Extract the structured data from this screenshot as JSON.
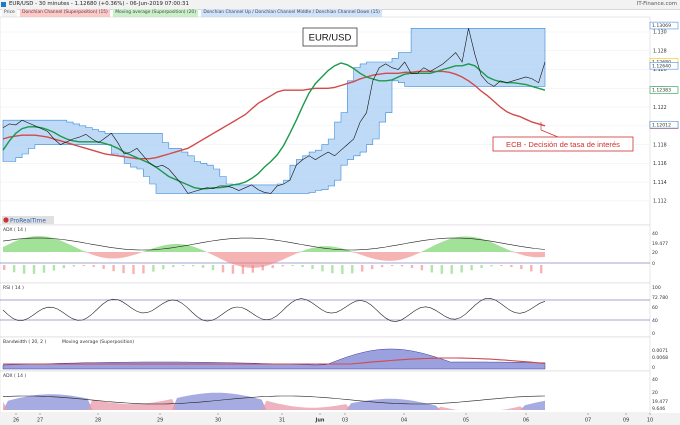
{
  "header": {
    "title": "EUR/USD - 30 minutes - 1.12680 (+0.36%) - 06-Jun-2019 07:00:31",
    "brand": "IT-Finance.com"
  },
  "legend": [
    {
      "text": "Price",
      "color": "#f2f2f2"
    },
    {
      "text": "Donchian Channel (Superposition) (15)",
      "color": "#ffc9c9"
    },
    {
      "text": "Moving average (Superposition) (20)",
      "color": "#c9f0c9"
    },
    {
      "text": "Donchian Channel Up / Donchian Channel Middle / Donchian Channel Down (15)",
      "color": "#cfe3fb"
    }
  ],
  "watermark": "ProRealTime",
  "annotations": {
    "pair_label": "EUR/USD",
    "ecb_label": "ECB - Decisión de tasa de interés"
  },
  "price_tags": [
    {
      "text": "1.13069",
      "value": 1.13069,
      "color": "#4a8fe0"
    },
    {
      "text": "1.12680",
      "value": 1.1268,
      "color": "#f0c000"
    },
    {
      "text": "1.12640",
      "value": 1.1264,
      "color": "#4a8fe0"
    },
    {
      "text": "1.12383",
      "value": 1.12383,
      "color": "#1a9a4a"
    },
    {
      "text": "1.12007",
      "value": 1.12007,
      "color": "#d24a4a"
    },
    {
      "text": "1.12012",
      "value": 1.12012,
      "color": "#4a8fe0"
    }
  ],
  "panel_labels": {
    "adx": "ADX ( 14 )",
    "rsi": "RSI ( 14 )",
    "bw": "Bandwidth ( 20, 2 )",
    "bw_ma": "Moving average (Superposition)",
    "adx2": "ADX ( 14 )"
  },
  "panel_tags": {
    "adx": [
      "40",
      "19.477",
      "20",
      "0"
    ],
    "rsi": [
      "100",
      "72.780",
      "60",
      "40",
      "0"
    ],
    "bw": [
      "0.0071",
      "0.0068",
      "0"
    ],
    "adx2": [
      "40",
      "20",
      "19.477",
      "9.646"
    ]
  },
  "chart_data": {
    "type": "line",
    "symbol": "EUR/USD",
    "timeframe": "30 minutes",
    "x_ticks": [
      "26",
      "27",
      "28",
      "29",
      "30",
      "31",
      "Jun",
      "03",
      "04",
      "05",
      "06",
      "07",
      "09",
      "10"
    ],
    "y_ticks": [
      1.112,
      1.114,
      1.116,
      1.118,
      1.12,
      1.122,
      1.124,
      1.126,
      1.128,
      1.13
    ],
    "ylim": [
      1.1106,
      1.1316
    ],
    "last_price": 1.1268,
    "series": [
      {
        "name": "Price",
        "color": "#000000",
        "values": [
          1.1198,
          1.1202,
          1.1201,
          1.1206,
          1.1203,
          1.12,
          1.1197,
          1.1194,
          1.1186,
          1.118,
          1.1183,
          1.1186,
          1.1188,
          1.1191,
          1.1186,
          1.1182,
          1.1187,
          1.1192,
          1.1182,
          1.117,
          1.1172,
          1.1176,
          1.1168,
          1.116,
          1.1156,
          1.1158,
          1.1154,
          1.1146,
          1.1138,
          1.1128,
          1.113,
          1.1132,
          1.1134,
          1.1133,
          1.1136,
          1.1136,
          1.1134,
          1.1131,
          1.1134,
          1.1137,
          1.1132,
          1.1129,
          1.1128,
          1.1136,
          1.1138,
          1.1142,
          1.1158,
          1.1164,
          1.1168,
          1.1164,
          1.1168,
          1.1172,
          1.1168,
          1.1174,
          1.118,
          1.1186,
          1.1204,
          1.1214,
          1.1248,
          1.1262,
          1.1266,
          1.1262,
          1.126,
          1.1268,
          1.1256,
          1.1256,
          1.1262,
          1.1258,
          1.1262,
          1.1266,
          1.1272,
          1.1278,
          1.1268,
          1.1304,
          1.1276,
          1.1254,
          1.1246,
          1.1242,
          1.1248,
          1.1246,
          1.1248,
          1.125,
          1.1252,
          1.125,
          1.1246,
          1.1268
        ]
      },
      {
        "name": "Moving average (Superposition) (20)",
        "color": "#1a9a4a",
        "values": [
          1.1174,
          1.1184,
          1.1192,
          1.1197,
          1.1199,
          1.1199,
          1.1198,
          1.1196,
          1.1193,
          1.1189,
          1.1186,
          1.1184,
          1.1183,
          1.1183,
          1.1183,
          1.1183,
          1.1181,
          1.1179,
          1.1176,
          1.1172,
          1.1169,
          1.1166,
          1.1163,
          1.116,
          1.1156,
          1.1151,
          1.1146,
          1.1143,
          1.114,
          1.1137,
          1.1134,
          1.1133,
          1.1133,
          1.1134,
          1.1134,
          1.1135,
          1.1137,
          1.1138,
          1.114,
          1.1144,
          1.1149,
          1.1156,
          1.1162,
          1.1169,
          1.1179,
          1.1192,
          1.1206,
          1.1221,
          1.1235,
          1.1245,
          1.1252,
          1.1259,
          1.1264,
          1.1267,
          1.1265,
          1.1261,
          1.1256,
          1.1252,
          1.125,
          1.1248,
          1.1248,
          1.1249,
          1.1252,
          1.1255,
          1.1256,
          1.1256,
          1.1256,
          1.1256,
          1.1258,
          1.126,
          1.1262,
          1.1264,
          1.1264,
          1.1266,
          1.1264,
          1.1258,
          1.1252,
          1.1249,
          1.1247,
          1.1246,
          1.1246,
          1.1245,
          1.1244,
          1.1242,
          1.124,
          1.1238
        ]
      },
      {
        "name": "Moving average (Superposition) (20) red",
        "color": "#d24a4a",
        "values": [
          1.1186,
          1.1188,
          1.1189,
          1.119,
          1.119,
          1.119,
          1.1189,
          1.1188,
          1.1186,
          1.1184,
          1.1182,
          1.118,
          1.1178,
          1.1176,
          1.1174,
          1.1172,
          1.117,
          1.1169,
          1.1168,
          1.1167,
          1.1166,
          1.1165,
          1.1165,
          1.1165,
          1.1166,
          1.1168,
          1.117,
          1.1172,
          1.1174,
          1.1176,
          1.118,
          1.1184,
          1.1188,
          1.1192,
          1.1196,
          1.12,
          1.1204,
          1.1208,
          1.1212,
          1.1218,
          1.1224,
          1.1228,
          1.1232,
          1.1236,
          1.1238,
          1.1238,
          1.1238,
          1.1238,
          1.1239,
          1.124,
          1.124,
          1.124,
          1.1241,
          1.1243,
          1.1245,
          1.1247,
          1.125,
          1.1252,
          1.1254,
          1.1255,
          1.1256,
          1.1256,
          1.1256,
          1.1257,
          1.1257,
          1.1258,
          1.1258,
          1.1258,
          1.1258,
          1.1258,
          1.1257,
          1.1255,
          1.1252,
          1.1248,
          1.1243,
          1.1237,
          1.1232,
          1.1226,
          1.122,
          1.1215,
          1.1212,
          1.121,
          1.1207,
          1.1204,
          1.1202,
          1.12
        ]
      }
    ],
    "donchian": {
      "upper": [
        1.1206,
        1.1206,
        1.1206,
        1.1206,
        1.1206,
        1.1206,
        1.1206,
        1.1206,
        1.1206,
        1.1206,
        1.1204,
        1.1202,
        1.12,
        1.1198,
        1.1196,
        1.1194,
        1.1192,
        1.1192,
        1.1192,
        1.1192,
        1.1192,
        1.1192,
        1.1192,
        1.1192,
        1.1192,
        1.1182,
        1.1176,
        1.1176,
        1.1172,
        1.1168,
        1.1162,
        1.116,
        1.1158,
        1.1154,
        1.1146,
        1.1138,
        1.1137,
        1.1137,
        1.1137,
        1.1137,
        1.1137,
        1.1137,
        1.1137,
        1.1138,
        1.1142,
        1.1158,
        1.1164,
        1.1168,
        1.1172,
        1.1174,
        1.118,
        1.1186,
        1.1204,
        1.1214,
        1.1248,
        1.1262,
        1.1266,
        1.1268,
        1.1268,
        1.1268,
        1.1268,
        1.1272,
        1.1278,
        1.1278,
        1.1304,
        1.1304,
        1.1304,
        1.1304,
        1.1304,
        1.1304,
        1.1304,
        1.1304,
        1.1304,
        1.1304,
        1.1304,
        1.1304,
        1.1304,
        1.1304,
        1.1304,
        1.1304,
        1.1304,
        1.1304,
        1.1304,
        1.1304,
        1.1304,
        1.1304
      ],
      "lower": [
        1.1162,
        1.1162,
        1.1166,
        1.117,
        1.1176,
        1.118,
        1.118,
        1.118,
        1.118,
        1.118,
        1.118,
        1.118,
        1.118,
        1.118,
        1.118,
        1.118,
        1.118,
        1.117,
        1.1168,
        1.116,
        1.1156,
        1.1154,
        1.1146,
        1.1138,
        1.1128,
        1.1128,
        1.1128,
        1.1128,
        1.1128,
        1.1128,
        1.1128,
        1.1128,
        1.1128,
        1.1128,
        1.1128,
        1.1128,
        1.1128,
        1.1128,
        1.1128,
        1.1128,
        1.1128,
        1.1128,
        1.1128,
        1.1128,
        1.1128,
        1.1128,
        1.1128,
        1.1128,
        1.1129,
        1.1131,
        1.1132,
        1.1136,
        1.1142,
        1.1158,
        1.1164,
        1.1168,
        1.1172,
        1.118,
        1.1186,
        1.1204,
        1.1214,
        1.1248,
        1.1246,
        1.1242,
        1.1242,
        1.1242,
        1.1242,
        1.1242,
        1.1242,
        1.1242,
        1.1242,
        1.1242,
        1.1242,
        1.1242,
        1.1242,
        1.1242,
        1.1242,
        1.1242,
        1.1242,
        1.1242,
        1.1242,
        1.1242,
        1.1242,
        1.1242,
        1.1242,
        1.1242
      ]
    },
    "panels": [
      {
        "name": "ADX ( 14 )",
        "ylim": [
          0,
          45
        ],
        "ticks": [
          0,
          20,
          40
        ]
      },
      {
        "name": "RSI ( 14 )",
        "ylim": [
          0,
          100
        ],
        "ticks": [
          0,
          40,
          60,
          100
        ]
      },
      {
        "name": "Bandwidth ( 20, 2 )",
        "ylim": [
          0,
          0.008
        ],
        "ticks": [
          0,
          0.0068,
          0.0071
        ]
      },
      {
        "name": "ADX ( 14 )",
        "ylim": [
          0,
          50
        ],
        "ticks": [
          9.646,
          19.477,
          20,
          40
        ]
      }
    ]
  }
}
